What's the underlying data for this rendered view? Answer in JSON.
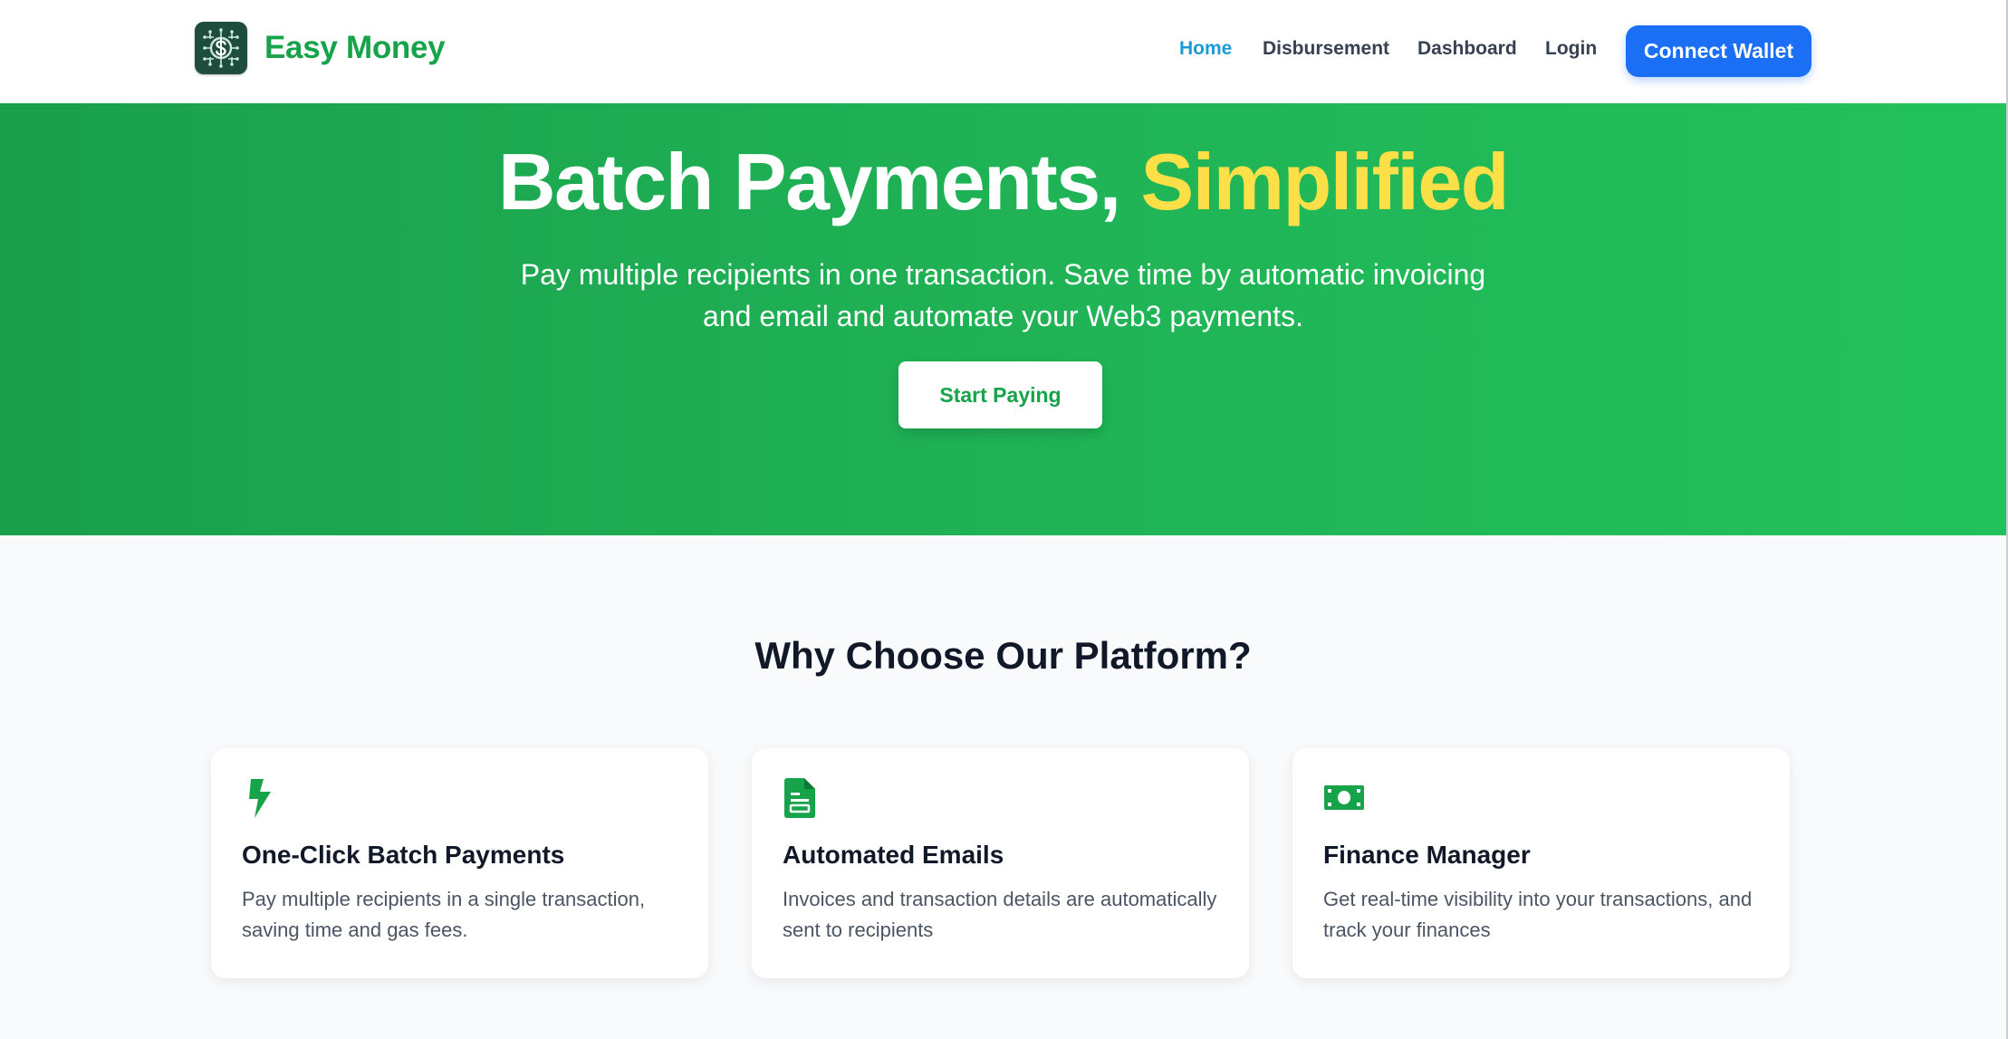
{
  "header": {
    "brand": "Easy Money",
    "logo_icon": "dollar-circuit-icon",
    "nav": [
      {
        "label": "Home",
        "active": true
      },
      {
        "label": "Disbursement",
        "active": false
      },
      {
        "label": "Dashboard",
        "active": false
      },
      {
        "label": "Login",
        "active": false
      }
    ],
    "connect_wallet_label": "Connect Wallet"
  },
  "hero": {
    "title_main": "Batch Payments,",
    "title_highlight": "Simplified",
    "subtitle": "Pay multiple recipients in one transaction. Save time by automatic invoicing and email and automate your Web3 payments.",
    "cta_label": "Start Paying"
  },
  "features": {
    "title": "Why Choose Our Platform?",
    "cards": [
      {
        "icon": "lightning-bolt-icon",
        "title": "One-Click Batch Payments",
        "text": "Pay multiple recipients in a single transaction, saving time and gas fees."
      },
      {
        "icon": "document-icon",
        "title": "Automated Emails",
        "text": "Invoices and transaction details are automatically sent to recipients"
      },
      {
        "icon": "money-bill-icon",
        "title": "Finance Manager",
        "text": "Get real-time visibility into your transactions, and track your finances"
      }
    ]
  },
  "colors": {
    "brand_green": "#16a34a",
    "hero_gradient_start": "#1a9f4c",
    "hero_gradient_end": "#22c15c",
    "highlight_yellow": "#fde047",
    "primary_blue": "#1a6ff5",
    "active_nav": "#1a9bd7"
  }
}
